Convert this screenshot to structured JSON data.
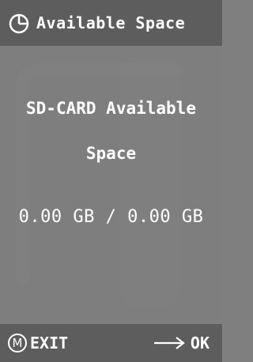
{
  "header": {
    "icon": "pie-chart-icon",
    "title": "Available Space"
  },
  "content": {
    "line1": "SD-CARD Available",
    "line2": "Space",
    "value": "0.00 GB / 0.00 GB"
  },
  "footer": {
    "exit_badge": "M",
    "exit_label": "EXIT",
    "ok_icon": "right-arrow-icon",
    "ok_label": "OK"
  },
  "colors": {
    "background": "#7e7e7e",
    "bar": "#5d5d5d",
    "text": "#ffffff"
  }
}
